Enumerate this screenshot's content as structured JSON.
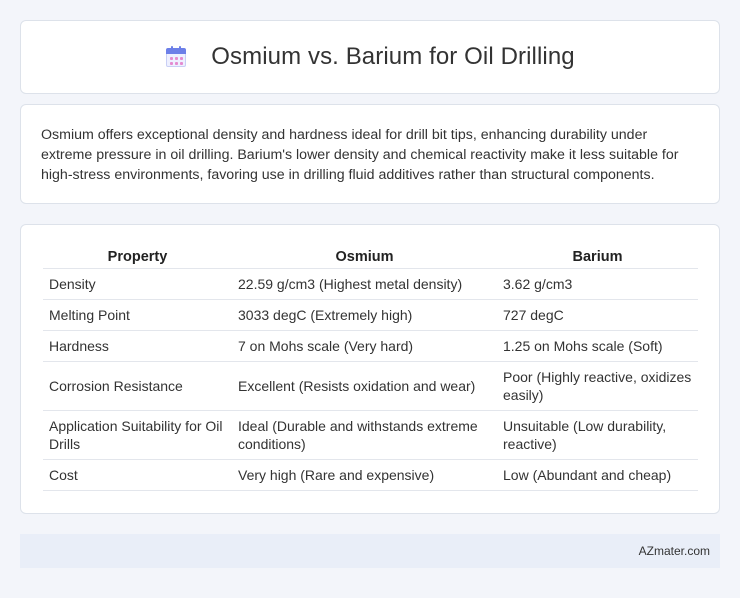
{
  "header": {
    "title": "Osmium vs. Barium for Oil Drilling",
    "icon": "calendar-icon"
  },
  "description": "Osmium offers exceptional density and hardness ideal for drill bit tips, enhancing durability under extreme pressure in oil drilling. Barium's lower density and chemical reactivity make it less suitable for high-stress environments, favoring use in drilling fluid additives rather than structural components.",
  "table": {
    "headers": [
      "Property",
      "Osmium",
      "Barium"
    ],
    "rows": [
      [
        "Density",
        "22.59 g/cm3 (Highest metal density)",
        "3.62 g/cm3"
      ],
      [
        "Melting Point",
        "3033 degC (Extremely high)",
        "727 degC"
      ],
      [
        "Hardness",
        "7 on Mohs scale (Very hard)",
        "1.25 on Mohs scale (Soft)"
      ],
      [
        "Corrosion Resistance",
        "Excellent (Resists oxidation and wear)",
        "Poor (Highly reactive, oxidizes easily)"
      ],
      [
        "Application Suitability for Oil Drills",
        "Ideal (Durable and withstands extreme conditions)",
        "Unsuitable (Low durability, reactive)"
      ],
      [
        "Cost",
        "Very high (Rare and expensive)",
        "Low (Abundant and cheap)"
      ]
    ]
  },
  "footer": {
    "brand": "AZmater.com"
  }
}
